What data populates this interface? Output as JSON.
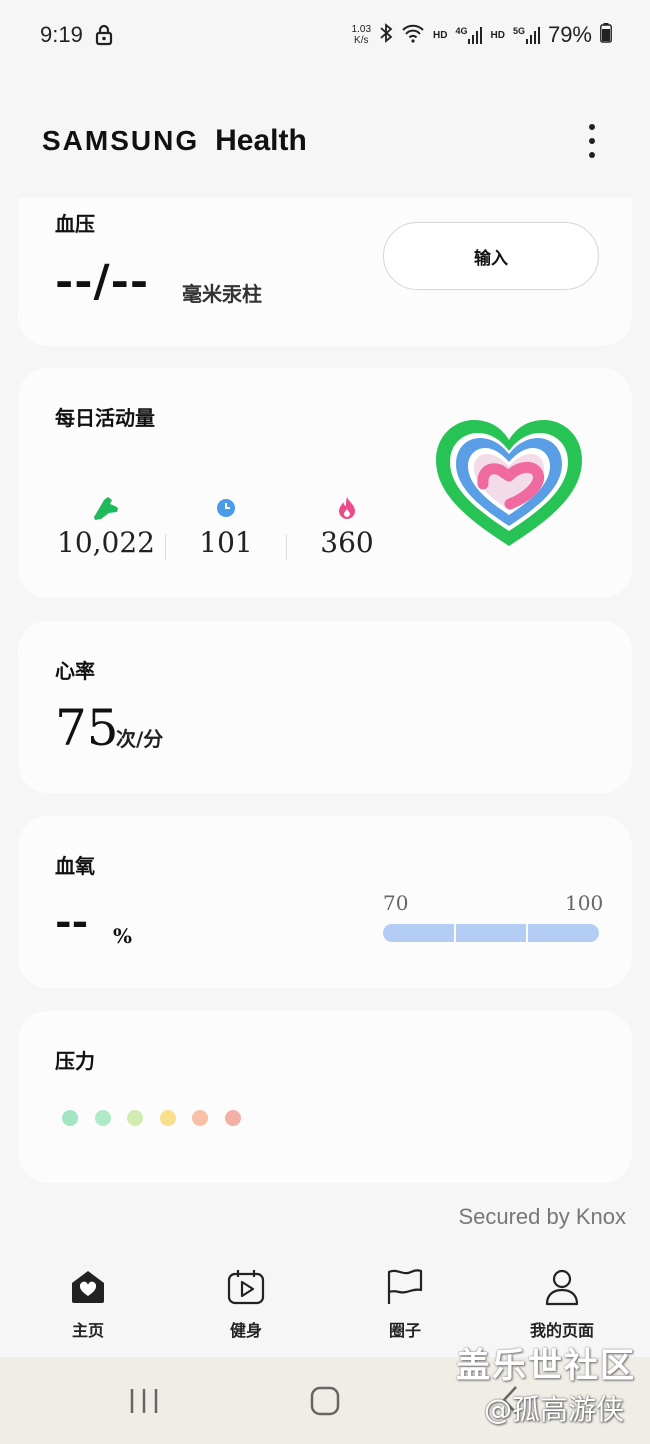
{
  "status_bar": {
    "time": "9:19",
    "net_speed_value": "1.03",
    "net_speed_unit": "K/s",
    "hd1": "HD",
    "hd2": "HD",
    "sig1_label": "4G",
    "sig2_label": "5G",
    "battery": "79%"
  },
  "app": {
    "brand_samsung": "SAMSUNG",
    "brand_health": "Health"
  },
  "blood_pressure": {
    "title": "血压",
    "value": "--/--",
    "unit": "毫米汞柱",
    "input_label": "输入"
  },
  "activity": {
    "title": "每日活动量",
    "steps": "10,022",
    "minutes": "101",
    "calories": "360",
    "colors": {
      "steps": "#1fb85b",
      "minutes": "#4a9be8",
      "calories": "#ec4b8a"
    }
  },
  "heart_rate": {
    "title": "心率",
    "value": "75",
    "unit": "次/分"
  },
  "blood_oxygen": {
    "title": "血氧",
    "value": "--",
    "unit": "%",
    "range_min": "70",
    "range_max": "100"
  },
  "stress": {
    "title": "压力",
    "dots": [
      "#a3e4c3",
      "#b0e9c6",
      "#d1ebb0",
      "#f8df8c",
      "#f7c0a7",
      "#f4b0a6"
    ]
  },
  "footer": {
    "knox": "Secured by Knox"
  },
  "bottom_nav": [
    {
      "label": "主页",
      "icon": "home-icon"
    },
    {
      "label": "健身",
      "icon": "fitness-play-icon"
    },
    {
      "label": "圈子",
      "icon": "flag-icon"
    },
    {
      "label": "我的页面",
      "icon": "person-icon"
    }
  ],
  "watermark": {
    "line1": "盖乐世社区",
    "line2": "@孤高游侠"
  }
}
